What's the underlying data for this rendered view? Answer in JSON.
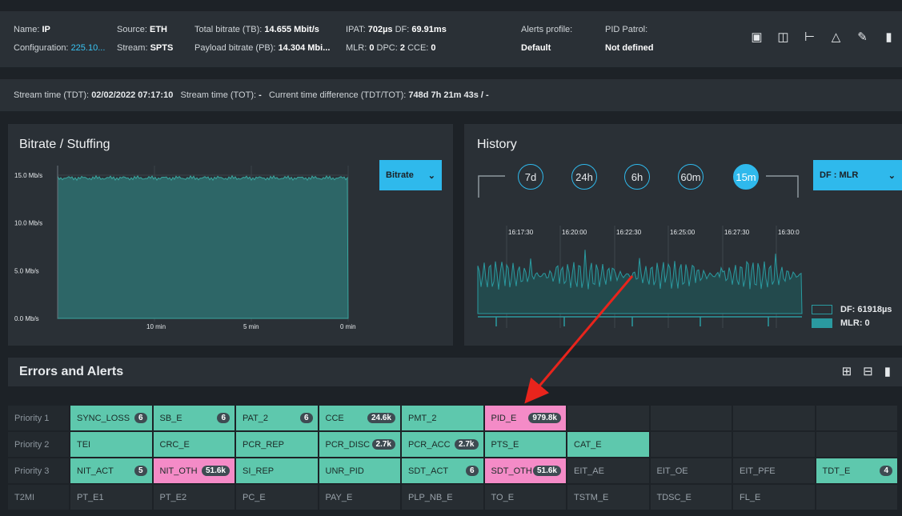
{
  "header": {
    "name_label": "Name:",
    "name_value": "IP",
    "config_label": "Configuration:",
    "config_value": "225.10...",
    "source_label": "Source:",
    "source_value": "ETH",
    "stream_label": "Stream:",
    "stream_value": "SPTS",
    "tb_label": "Total bitrate (TB):",
    "tb_value": "14.655 Mbit/s",
    "pb_label": "Payload bitrate (PB):",
    "pb_value": "14.304 Mbi...",
    "ipat_label": "IPAT:",
    "ipat_value": "702µs",
    "df_label": "DF:",
    "df_value": "69.91ms",
    "mlr_label": "MLR:",
    "mlr_value": "0",
    "dpc_label": "DPC:",
    "dpc_value": "2",
    "cce_label": "CCE:",
    "cce_value": "0",
    "alerts_label": "Alerts profile:",
    "alerts_value": "Default",
    "pid_label": "PID Patrol:",
    "pid_value": "Not defined"
  },
  "toolbar": {
    "icons": [
      "monitor-icon",
      "screenshot-icon",
      "tree-icon",
      "bell-icon",
      "edit-icon",
      "delete-icon"
    ]
  },
  "stream_time": {
    "tdt_label": "Stream time (TDT):",
    "tdt_value": "02/02/2022 07:17:10",
    "tot_label": "Stream time (TOT):",
    "tot_value": "-",
    "diff_label": "Current time difference (TDT/TOT):",
    "diff_value": "748d 7h 21m 43s / -"
  },
  "bitrate_panel": {
    "title": "Bitrate / Stuffing",
    "dropdown": "Bitrate",
    "chart_data": {
      "type": "area",
      "y_ticks": [
        "15.0 Mb/s",
        "10.0 Mb/s",
        "5.0 Mb/s",
        "0.0 Mb/s"
      ],
      "x_ticks": [
        "10 min",
        "5 min",
        "0 min"
      ],
      "ylim": [
        0,
        16
      ],
      "value_level": 14.7
    }
  },
  "history_panel": {
    "title": "History",
    "ranges": [
      "7d",
      "24h",
      "6h",
      "60m",
      "15m"
    ],
    "active_range": "15m",
    "dropdown": "DF : MLR",
    "chart_data": {
      "type": "line",
      "x_ticks": [
        "16:17:30",
        "16:20:00",
        "16:22:30",
        "16:25:00",
        "16:27:30",
        "16:30:0"
      ],
      "series": [
        {
          "name": "DF: 61918µs",
          "color": "#2a9aa0"
        },
        {
          "name": "MLR: 0",
          "color": "#2a9aa0"
        }
      ]
    }
  },
  "errors": {
    "title": "Errors and Alerts",
    "icons": [
      "grid-icon",
      "history-table-icon",
      "delete-all-icon"
    ],
    "rows": [
      {
        "label": "Priority 1",
        "cells": [
          {
            "name": "SYNC_LOSS",
            "count": "6",
            "status": "green"
          },
          {
            "name": "SB_E",
            "count": "6",
            "status": "green"
          },
          {
            "name": "PAT_2",
            "count": "6",
            "status": "green"
          },
          {
            "name": "CCE",
            "count": "24.6k",
            "status": "green"
          },
          {
            "name": "PMT_2",
            "count": "",
            "status": "green"
          },
          {
            "name": "PID_E",
            "count": "979.8k",
            "status": "pink"
          },
          {
            "name": "",
            "count": "",
            "status": "dark"
          },
          {
            "name": "",
            "count": "",
            "status": "dark"
          },
          {
            "name": "",
            "count": "",
            "status": "dark"
          },
          {
            "name": "",
            "count": "",
            "status": "dark"
          }
        ]
      },
      {
        "label": "Priority 2",
        "cells": [
          {
            "name": "TEI",
            "count": "",
            "status": "green"
          },
          {
            "name": "CRC_E",
            "count": "",
            "status": "green"
          },
          {
            "name": "PCR_REP",
            "count": "",
            "status": "green"
          },
          {
            "name": "PCR_DISC",
            "count": "2.7k",
            "status": "green"
          },
          {
            "name": "PCR_ACC",
            "count": "2.7k",
            "status": "green"
          },
          {
            "name": "PTS_E",
            "count": "",
            "status": "green"
          },
          {
            "name": "CAT_E",
            "count": "",
            "status": "green"
          },
          {
            "name": "",
            "count": "",
            "status": "dark"
          },
          {
            "name": "",
            "count": "",
            "status": "dark"
          },
          {
            "name": "",
            "count": "",
            "status": "dark"
          }
        ]
      },
      {
        "label": "Priority 3",
        "cells": [
          {
            "name": "NIT_ACT",
            "count": "5",
            "status": "green"
          },
          {
            "name": "NIT_OTH",
            "count": "51.6k",
            "status": "pink"
          },
          {
            "name": "SI_REP",
            "count": "",
            "status": "green"
          },
          {
            "name": "UNR_PID",
            "count": "",
            "status": "green"
          },
          {
            "name": "SDT_ACT",
            "count": "6",
            "status": "green"
          },
          {
            "name": "SDT_OTH",
            "count": "51.6k",
            "status": "pink"
          },
          {
            "name": "EIT_AE",
            "count": "",
            "status": "dark"
          },
          {
            "name": "EIT_OE",
            "count": "",
            "status": "dark"
          },
          {
            "name": "EIT_PFE",
            "count": "",
            "status": "dark"
          },
          {
            "name": "TDT_E",
            "count": "4",
            "status": "green"
          }
        ]
      },
      {
        "label": "T2MI",
        "cells": [
          {
            "name": "PT_E1",
            "count": "",
            "status": "dark"
          },
          {
            "name": "PT_E2",
            "count": "",
            "status": "dark"
          },
          {
            "name": "PC_E",
            "count": "",
            "status": "dark"
          },
          {
            "name": "PAY_E",
            "count": "",
            "status": "dark"
          },
          {
            "name": "PLP_NB_E",
            "count": "",
            "status": "dark"
          },
          {
            "name": "TO_E",
            "count": "",
            "status": "dark"
          },
          {
            "name": "TSTM_E",
            "count": "",
            "status": "dark"
          },
          {
            "name": "TDSC_E",
            "count": "",
            "status": "dark"
          },
          {
            "name": "FL_E",
            "count": "",
            "status": "dark"
          },
          {
            "name": "",
            "count": "",
            "status": "dark"
          }
        ]
      }
    ]
  },
  "colors": {
    "accent": "#2fb9ec",
    "ok": "#5ec8ad",
    "alert": "#f48bc7",
    "annotation_arrow": "#e8241c"
  }
}
